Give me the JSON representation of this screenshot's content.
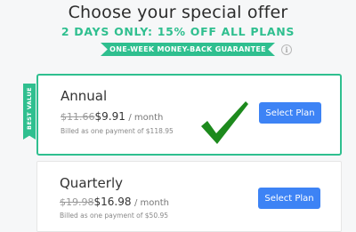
{
  "header": {
    "title": "Choose your special offer",
    "subtitle": "2 DAYS ONLY: 15% OFF ALL PLANS",
    "guarantee": "ONE-WEEK MONEY-BACK GUARANTEE",
    "info_icon": "i"
  },
  "badge": {
    "label": "BEST VALUE"
  },
  "plans": [
    {
      "name": "Annual",
      "old_price": "$11.66",
      "new_price": "$9.91",
      "period": "/ month",
      "billed": "Billed as one payment of $118.95",
      "button": "Select Plan"
    },
    {
      "name": "Quarterly",
      "old_price": "$19.98",
      "new_price": "$16.98",
      "period": "/ month",
      "billed": "Billed as one payment of $50.95",
      "button": "Select Plan"
    }
  ],
  "colors": {
    "accent_green": "#2fbf8f",
    "button_blue": "#3d83f5",
    "checkmark_green": "#1d8a1d",
    "title_text": "#2b2b2b"
  },
  "icons": {
    "info": "info-circle-icon",
    "selected": "checkmark-icon"
  }
}
